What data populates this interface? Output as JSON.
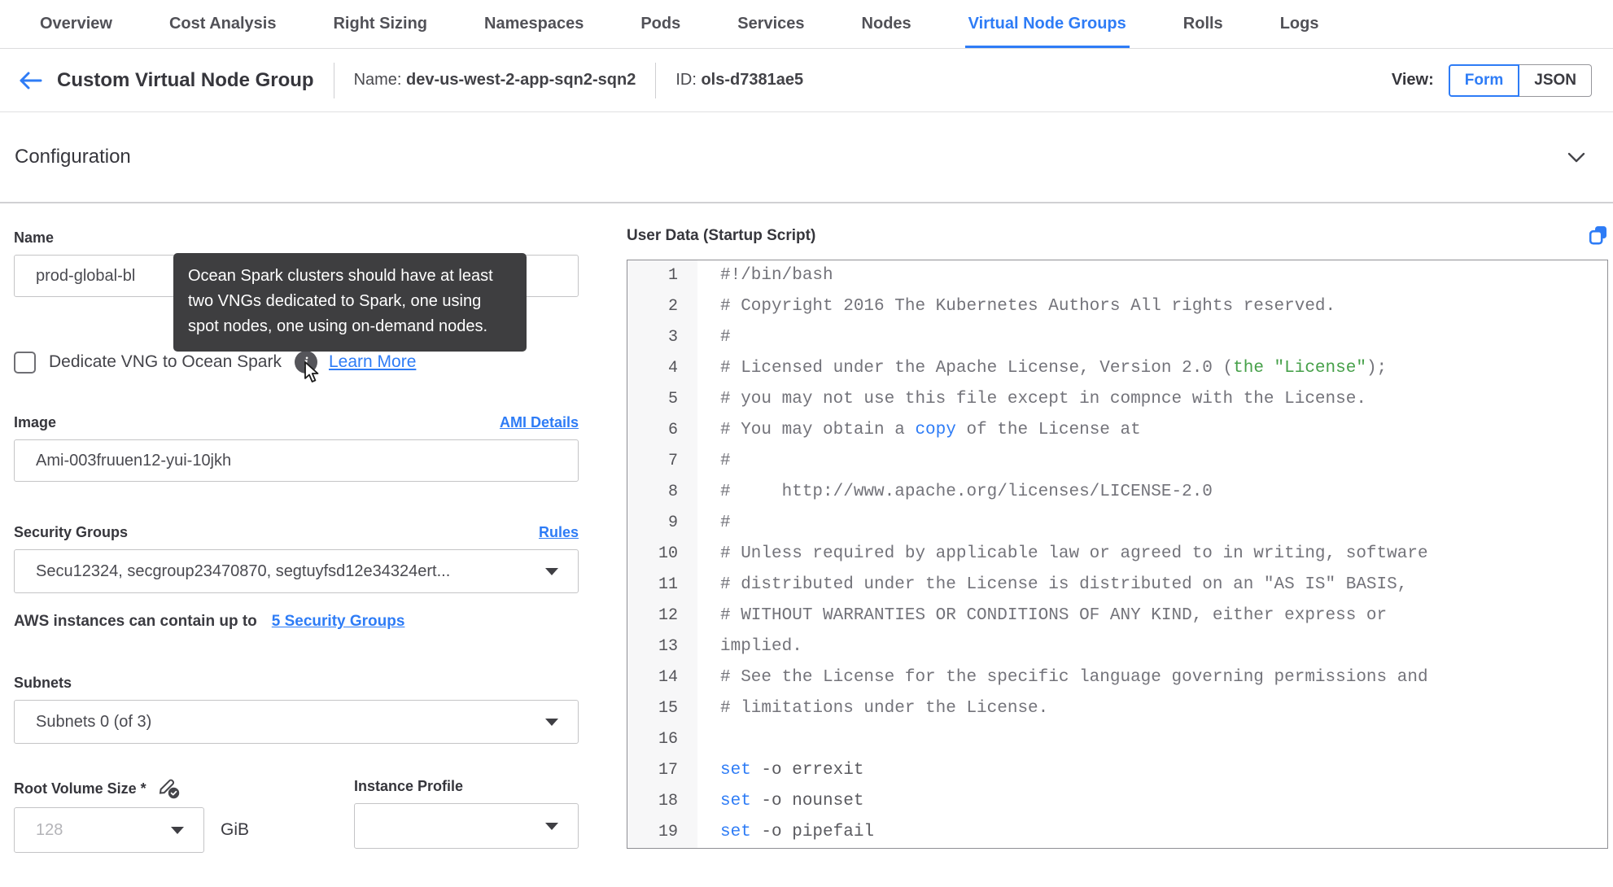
{
  "colors": {
    "accent": "#2e7cf6",
    "green": "#46a049",
    "tooltip_bg": "#3e3e40",
    "comment_gray": "#73737a"
  },
  "icons": {
    "back": "back-arrow-icon",
    "collapse": "chevron-down-icon",
    "info": "info-icon",
    "pointer": "cursor-icon",
    "edit": "edit-check-icon",
    "copy": "copy-icon",
    "dropdown": "caret-down-icon"
  },
  "tabs": {
    "items": [
      {
        "label": "Overview",
        "active": false
      },
      {
        "label": "Cost Analysis",
        "active": false
      },
      {
        "label": "Right Sizing",
        "active": false
      },
      {
        "label": "Namespaces",
        "active": false
      },
      {
        "label": "Pods",
        "active": false
      },
      {
        "label": "Services",
        "active": false
      },
      {
        "label": "Nodes",
        "active": false
      },
      {
        "label": "Virtual Node Groups",
        "active": true
      },
      {
        "label": "Rolls",
        "active": false
      },
      {
        "label": "Logs",
        "active": false
      }
    ]
  },
  "header": {
    "title": "Custom Virtual Node Group",
    "name_label": "Name:",
    "name_value": "dev-us-west-2-app-sqn2-sqn2",
    "id_label": "ID:",
    "id_value": "ols-d7381ae5",
    "view_label": "View:",
    "view_options": [
      "Form",
      "JSON"
    ],
    "view_selected": "Form"
  },
  "section": {
    "title": "Configuration"
  },
  "form": {
    "name": {
      "label": "Name",
      "value": "prod-global-bl"
    },
    "tooltip": {
      "text": "Ocean Spark clusters should have at least two VNGs dedicated to Spark, one using spot nodes, one using on-demand nodes."
    },
    "dedicate": {
      "label": "Dedicate VNG to Ocean Spark",
      "checked": false,
      "learn_more": "Learn More"
    },
    "image": {
      "label": "Image",
      "link": "AMI Details",
      "value": "Ami-003fruuen12-yui-10jkh"
    },
    "security_groups": {
      "label": "Security Groups",
      "link": "Rules",
      "value": "Secu12324, secgroup23470870, segtuyfsd12e34324ert...",
      "hint_text": "AWS instances can contain up to",
      "hint_link": "5 Security Groups"
    },
    "subnets": {
      "label": "Subnets",
      "value": "Subnets 0 (of 3)"
    },
    "root_volume": {
      "label": "Root Volume Size *",
      "placeholder": "128",
      "unit": "GiB"
    },
    "instance_profile": {
      "label": "Instance Profile",
      "value": ""
    }
  },
  "editor": {
    "title": "User Data (Startup Script)",
    "lines": [
      [
        [
          "#!/bin/bash",
          "cm"
        ]
      ],
      [
        [
          "# Copyright 2016 The Kubernetes Authors All rights reserved.",
          "cm"
        ]
      ],
      [
        [
          "#",
          "cm"
        ]
      ],
      [
        [
          "# Licensed under the Apache License, Version 2.0 (",
          "cm"
        ],
        [
          "the \"License\"",
          "gr"
        ],
        [
          ");",
          "cm"
        ]
      ],
      [
        [
          "# you may not use this file except in compnce with the License.",
          "cm"
        ]
      ],
      [
        [
          "# You may obtain a ",
          "cm"
        ],
        [
          "copy",
          "bl"
        ],
        [
          " of the License at",
          "cm"
        ]
      ],
      [
        [
          "#",
          "cm"
        ]
      ],
      [
        [
          "#     http://www.apache.org/licenses/LICENSE-2.0",
          "cm"
        ]
      ],
      [
        [
          "#",
          "cm"
        ]
      ],
      [
        [
          "# Unless required by applicable law or agreed to in writing, software",
          "cm"
        ]
      ],
      [
        [
          "# distributed under the License is distributed on an \"AS IS\" BASIS,",
          "cm"
        ]
      ],
      [
        [
          "# WITHOUT WARRANTIES OR CONDITIONS OF ANY KIND, either express or",
          "cm"
        ]
      ],
      [
        [
          "implied.",
          "cm"
        ]
      ],
      [
        [
          "# See the License for the specific language governing permissions and",
          "cm"
        ]
      ],
      [
        [
          "# limitations under the License.",
          "cm"
        ]
      ],
      [],
      [
        [
          "set",
          "bl"
        ],
        [
          " -o errexit",
          "pl"
        ]
      ],
      [
        [
          "set",
          "bl"
        ],
        [
          " -o nounset",
          "pl"
        ]
      ],
      [
        [
          "set",
          "bl"
        ],
        [
          " -o pipefail",
          "pl"
        ]
      ]
    ]
  }
}
